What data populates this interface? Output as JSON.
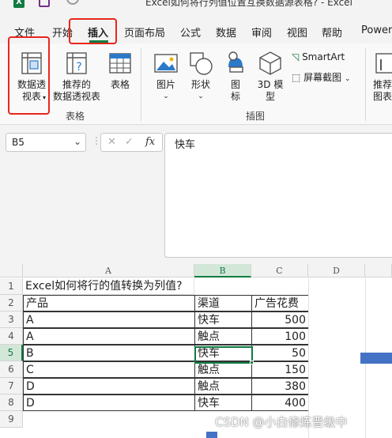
{
  "titlebar": {
    "logo_letter": "X",
    "title": "Excel如何将行列值位置互换数据源表格? - Excel"
  },
  "tabs": [
    {
      "label": "文件"
    },
    {
      "label": "开始"
    },
    {
      "label": "插入"
    },
    {
      "label": "页面布局"
    },
    {
      "label": "公式"
    },
    {
      "label": "数据"
    },
    {
      "label": "审阅"
    },
    {
      "label": "视图"
    },
    {
      "label": "帮助"
    },
    {
      "label": "Power"
    }
  ],
  "ribbon": {
    "pivot_line1": "数据透",
    "pivot_line2": "视表",
    "recommended_line1": "推荐的",
    "recommended_line2": "数据透视表",
    "table": "表格",
    "group_tables": "表格",
    "pictures": "图片",
    "shapes": "形状",
    "icons_line1": "图",
    "icons_line2": "标",
    "models_line1": "3D 模",
    "models_line2": "型",
    "smartart": "SmartArt",
    "screenshot": "屏幕截图",
    "group_illustrations": "插图",
    "recommended_charts_line1": "推荐",
    "recommended_charts_line2": "图表"
  },
  "formula_bar": {
    "name_box": "B5",
    "fx": "fx",
    "value": "快车"
  },
  "sheet": {
    "columns": [
      "A",
      "B",
      "C",
      "D"
    ],
    "rows": [
      "1",
      "2",
      "3",
      "4",
      "5",
      "6",
      "7",
      "8",
      "9"
    ],
    "title": "Excel如何将行的值转换为列值?",
    "headers": [
      "产品",
      "渠道",
      "广告花费"
    ],
    "data": [
      [
        "A",
        "快车",
        "500"
      ],
      [
        "A",
        "触点",
        "100"
      ],
      [
        "B",
        "快车",
        "50"
      ],
      [
        "C",
        "触点",
        "150"
      ],
      [
        "D",
        "触点",
        "380"
      ],
      [
        "D",
        "快车",
        "400"
      ]
    ]
  },
  "watermark": "CSDN @小白修炼晋级中",
  "colors": {
    "accent": "#107c41",
    "highlight": "#e8261d",
    "chart_blue": "#4472c4"
  }
}
